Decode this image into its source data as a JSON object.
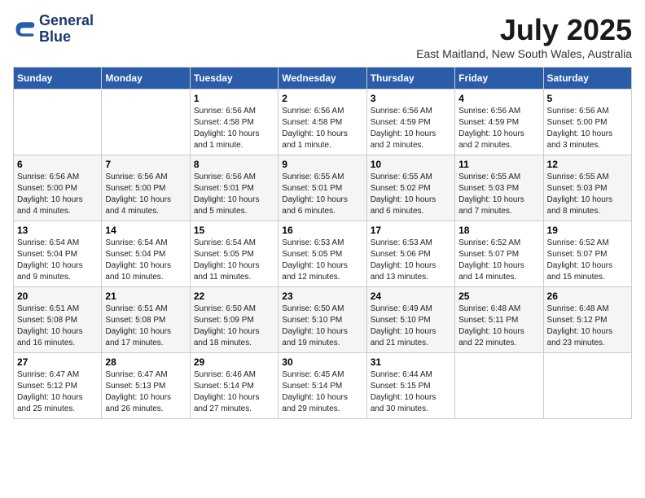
{
  "header": {
    "logo_line1": "General",
    "logo_line2": "Blue",
    "month": "July 2025",
    "location": "East Maitland, New South Wales, Australia"
  },
  "days_of_week": [
    "Sunday",
    "Monday",
    "Tuesday",
    "Wednesday",
    "Thursday",
    "Friday",
    "Saturday"
  ],
  "weeks": [
    [
      {
        "day": "",
        "info": ""
      },
      {
        "day": "",
        "info": ""
      },
      {
        "day": "1",
        "info": "Sunrise: 6:56 AM\nSunset: 4:58 PM\nDaylight: 10 hours and 1 minute."
      },
      {
        "day": "2",
        "info": "Sunrise: 6:56 AM\nSunset: 4:58 PM\nDaylight: 10 hours and 1 minute."
      },
      {
        "day": "3",
        "info": "Sunrise: 6:56 AM\nSunset: 4:59 PM\nDaylight: 10 hours and 2 minutes."
      },
      {
        "day": "4",
        "info": "Sunrise: 6:56 AM\nSunset: 4:59 PM\nDaylight: 10 hours and 2 minutes."
      },
      {
        "day": "5",
        "info": "Sunrise: 6:56 AM\nSunset: 5:00 PM\nDaylight: 10 hours and 3 minutes."
      }
    ],
    [
      {
        "day": "6",
        "info": "Sunrise: 6:56 AM\nSunset: 5:00 PM\nDaylight: 10 hours and 4 minutes."
      },
      {
        "day": "7",
        "info": "Sunrise: 6:56 AM\nSunset: 5:00 PM\nDaylight: 10 hours and 4 minutes."
      },
      {
        "day": "8",
        "info": "Sunrise: 6:56 AM\nSunset: 5:01 PM\nDaylight: 10 hours and 5 minutes."
      },
      {
        "day": "9",
        "info": "Sunrise: 6:55 AM\nSunset: 5:01 PM\nDaylight: 10 hours and 6 minutes."
      },
      {
        "day": "10",
        "info": "Sunrise: 6:55 AM\nSunset: 5:02 PM\nDaylight: 10 hours and 6 minutes."
      },
      {
        "day": "11",
        "info": "Sunrise: 6:55 AM\nSunset: 5:03 PM\nDaylight: 10 hours and 7 minutes."
      },
      {
        "day": "12",
        "info": "Sunrise: 6:55 AM\nSunset: 5:03 PM\nDaylight: 10 hours and 8 minutes."
      }
    ],
    [
      {
        "day": "13",
        "info": "Sunrise: 6:54 AM\nSunset: 5:04 PM\nDaylight: 10 hours and 9 minutes."
      },
      {
        "day": "14",
        "info": "Sunrise: 6:54 AM\nSunset: 5:04 PM\nDaylight: 10 hours and 10 minutes."
      },
      {
        "day": "15",
        "info": "Sunrise: 6:54 AM\nSunset: 5:05 PM\nDaylight: 10 hours and 11 minutes."
      },
      {
        "day": "16",
        "info": "Sunrise: 6:53 AM\nSunset: 5:05 PM\nDaylight: 10 hours and 12 minutes."
      },
      {
        "day": "17",
        "info": "Sunrise: 6:53 AM\nSunset: 5:06 PM\nDaylight: 10 hours and 13 minutes."
      },
      {
        "day": "18",
        "info": "Sunrise: 6:52 AM\nSunset: 5:07 PM\nDaylight: 10 hours and 14 minutes."
      },
      {
        "day": "19",
        "info": "Sunrise: 6:52 AM\nSunset: 5:07 PM\nDaylight: 10 hours and 15 minutes."
      }
    ],
    [
      {
        "day": "20",
        "info": "Sunrise: 6:51 AM\nSunset: 5:08 PM\nDaylight: 10 hours and 16 minutes."
      },
      {
        "day": "21",
        "info": "Sunrise: 6:51 AM\nSunset: 5:08 PM\nDaylight: 10 hours and 17 minutes."
      },
      {
        "day": "22",
        "info": "Sunrise: 6:50 AM\nSunset: 5:09 PM\nDaylight: 10 hours and 18 minutes."
      },
      {
        "day": "23",
        "info": "Sunrise: 6:50 AM\nSunset: 5:10 PM\nDaylight: 10 hours and 19 minutes."
      },
      {
        "day": "24",
        "info": "Sunrise: 6:49 AM\nSunset: 5:10 PM\nDaylight: 10 hours and 21 minutes."
      },
      {
        "day": "25",
        "info": "Sunrise: 6:48 AM\nSunset: 5:11 PM\nDaylight: 10 hours and 22 minutes."
      },
      {
        "day": "26",
        "info": "Sunrise: 6:48 AM\nSunset: 5:12 PM\nDaylight: 10 hours and 23 minutes."
      }
    ],
    [
      {
        "day": "27",
        "info": "Sunrise: 6:47 AM\nSunset: 5:12 PM\nDaylight: 10 hours and 25 minutes."
      },
      {
        "day": "28",
        "info": "Sunrise: 6:47 AM\nSunset: 5:13 PM\nDaylight: 10 hours and 26 minutes."
      },
      {
        "day": "29",
        "info": "Sunrise: 6:46 AM\nSunset: 5:14 PM\nDaylight: 10 hours and 27 minutes."
      },
      {
        "day": "30",
        "info": "Sunrise: 6:45 AM\nSunset: 5:14 PM\nDaylight: 10 hours and 29 minutes."
      },
      {
        "day": "31",
        "info": "Sunrise: 6:44 AM\nSunset: 5:15 PM\nDaylight: 10 hours and 30 minutes."
      },
      {
        "day": "",
        "info": ""
      },
      {
        "day": "",
        "info": ""
      }
    ]
  ]
}
